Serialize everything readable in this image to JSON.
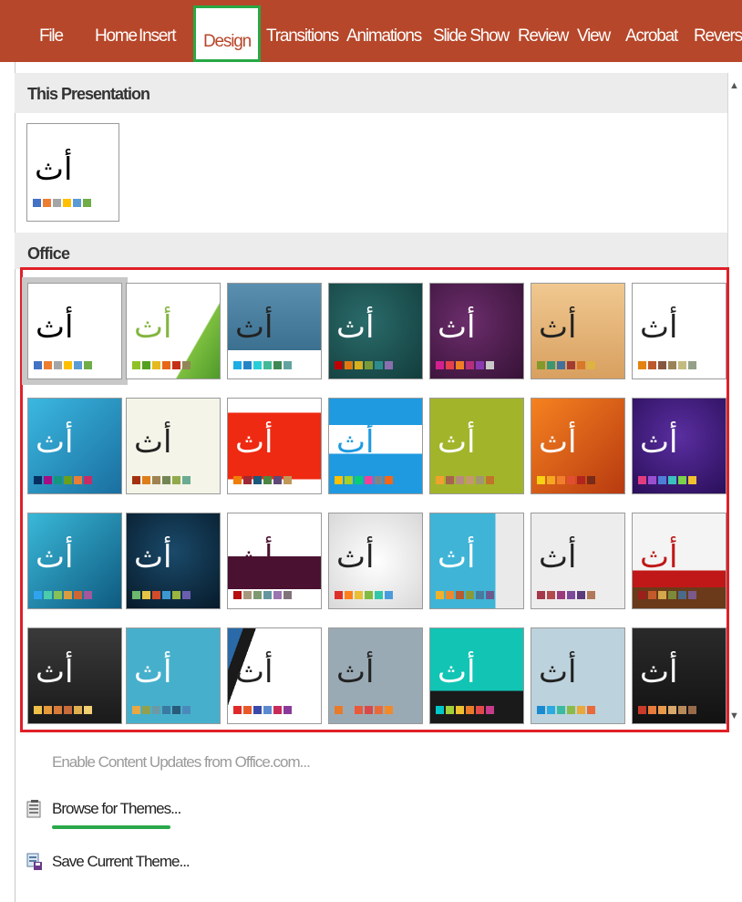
{
  "ribbon": {
    "tabs": [
      "File",
      "Home",
      "Insert",
      "Design",
      "Transitions",
      "Animations",
      "Slide Show",
      "Review",
      "View",
      "Acrobat",
      "Reverso"
    ],
    "active_tab": "Design"
  },
  "sections": {
    "this_presentation": "This Presentation",
    "office": "Office"
  },
  "theme_glyph": "أث",
  "commands": {
    "enable_updates": "Enable Content Updates from Office.com...",
    "browse_themes": "Browse for Themes...",
    "save_theme": "Save Current Theme..."
  },
  "colors": {
    "ribbon": "#b7472a",
    "highlight_tab": "#27a844",
    "gallery_border": "#e02028"
  }
}
